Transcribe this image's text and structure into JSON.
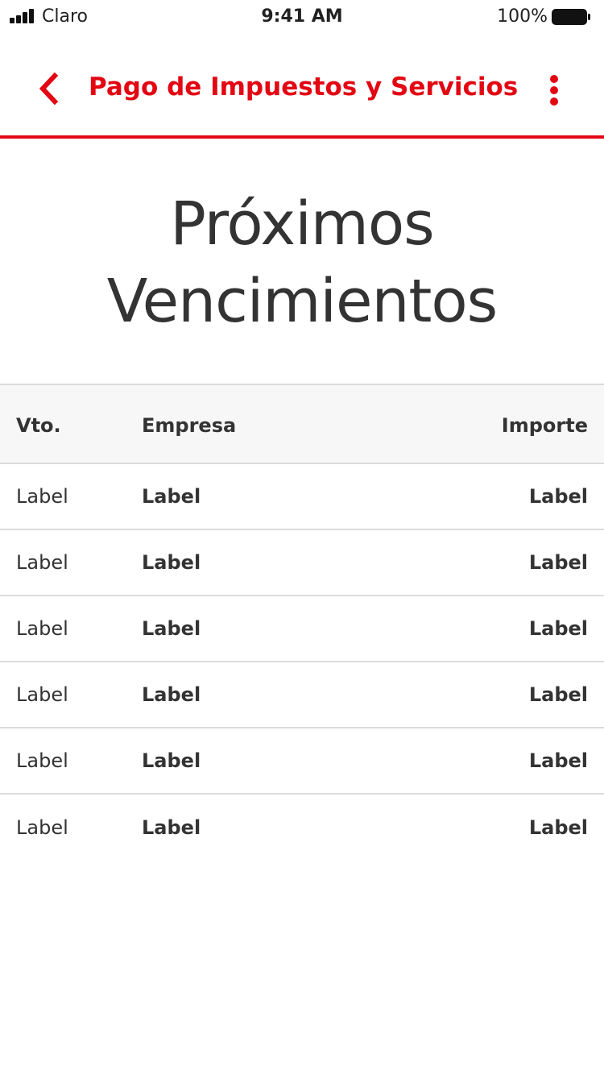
{
  "status_bar": {
    "carrier": "Claro",
    "time": "9:41 AM",
    "battery_percent": "100%"
  },
  "nav": {
    "title": "Pago de Impuestos y Servicios",
    "back_icon": "chevron-left-icon",
    "more_icon": "more-vertical-icon",
    "accent_color": "#e30613"
  },
  "page": {
    "title_line1": "Próximos",
    "title_line2": "Vencimientos"
  },
  "table": {
    "headers": {
      "vto": "Vto.",
      "empresa": "Empresa",
      "importe": "Importe"
    },
    "rows": [
      {
        "vto": "Label",
        "empresa": "Label",
        "importe": "Label"
      },
      {
        "vto": "Label",
        "empresa": "Label",
        "importe": "Label"
      },
      {
        "vto": "Label",
        "empresa": "Label",
        "importe": "Label"
      },
      {
        "vto": "Label",
        "empresa": "Label",
        "importe": "Label"
      },
      {
        "vto": "Label",
        "empresa": "Label",
        "importe": "Label"
      },
      {
        "vto": "Label",
        "empresa": "Label",
        "importe": "Label"
      }
    ]
  }
}
